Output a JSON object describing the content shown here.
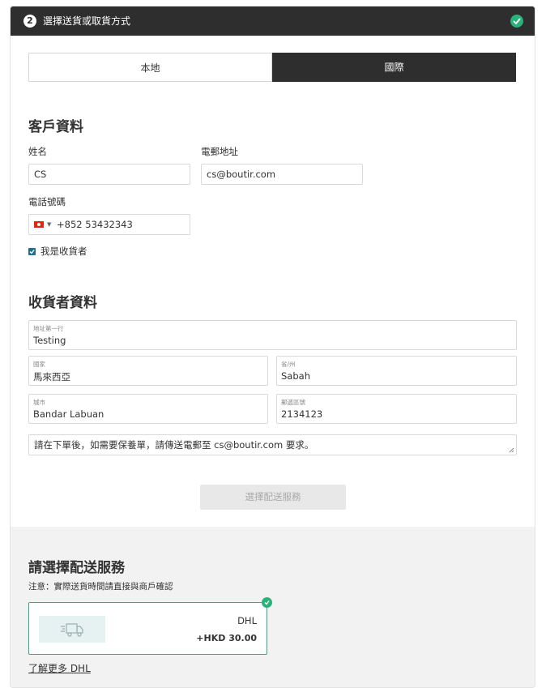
{
  "header": {
    "step_number": "2",
    "title": "選擇送貨或取貨方式"
  },
  "tabs": [
    {
      "label": "本地",
      "active": false
    },
    {
      "label": "國際",
      "active": true
    }
  ],
  "customer_section": {
    "title": "客戶資料",
    "name_label": "姓名",
    "name_value": "CS",
    "email_label": "電郵地址",
    "email_value": "cs@boutir.com",
    "phone_label": "電話號碼",
    "phone_country_code": "+852",
    "phone_number": "53432343",
    "is_recipient_label": "我是收貨者",
    "is_recipient_checked": true
  },
  "recipient_section": {
    "title": "收貨者資料",
    "address_line1_label": "地址第一行",
    "address_line1_value": "Testing",
    "country_label": "國家",
    "country_value": "馬來西亞",
    "state_label": "省/州",
    "state_value": "Sabah",
    "city_label": "城市",
    "city_value": "Bandar Labuan",
    "postal_label": "郵遞區號",
    "postal_value": "2134123",
    "note_value": "請在下單後，如需要保養單，請傳送電郵至 cs@boutir.com 要求。",
    "select_service_button": "選擇配送服務"
  },
  "shipping": {
    "title": "請選擇配送服務",
    "notice": "注意：實際送貨時間請直接與商戶確認",
    "option": {
      "carrier": "DHL",
      "price": "+HKD 30.00",
      "selected": true
    },
    "learn_more": "了解更多 DHL"
  },
  "colors": {
    "header_bg": "#2e2e2e",
    "accent_green": "#2ab27b",
    "checkbox_blue": "#1f6e8c",
    "section_gray": "#f2f2f2"
  }
}
